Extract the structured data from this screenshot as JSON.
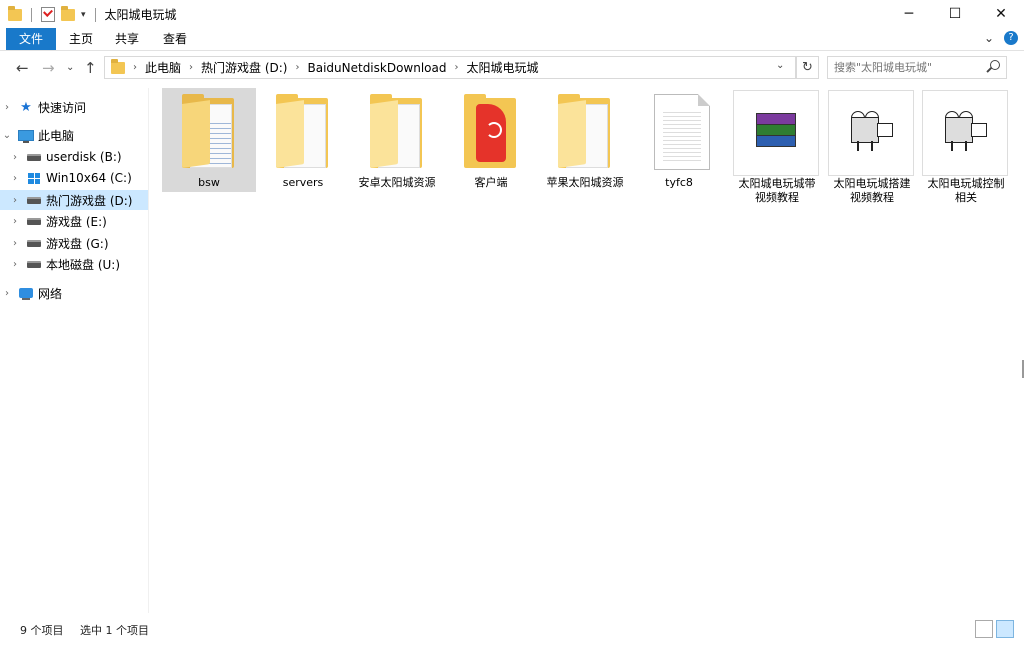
{
  "window": {
    "title": "太阳城电玩城",
    "controls": {
      "minimize": "─",
      "maximize": "☐",
      "close": "✕"
    }
  },
  "ribbon": {
    "tabs": {
      "file": "文件",
      "home": "主页",
      "share": "共享",
      "view": "查看"
    },
    "expand": "⌄",
    "help": "?"
  },
  "nav": {
    "back": "←",
    "forward": "→",
    "recent": "⌄",
    "up": "↑"
  },
  "address": {
    "crumbs": [
      "此电脑",
      "热门游戏盘 (D:)",
      "BaiduNetdiskDownload",
      "太阳城电玩城"
    ],
    "separator": "›",
    "dropdown": "⌄",
    "refresh": "↻"
  },
  "search": {
    "placeholder": "搜索\"太阳城电玩城\""
  },
  "sidebar": {
    "items": [
      {
        "label": "快速访问",
        "icon": "star-icon"
      },
      {
        "label": "此电脑",
        "icon": "computer-icon"
      },
      {
        "label": "userdisk (B:)",
        "icon": "drive-icon"
      },
      {
        "label": "Win10x64 (C:)",
        "icon": "windows-drive-icon"
      },
      {
        "label": "热门游戏盘 (D:)",
        "icon": "drive-icon",
        "selected": true
      },
      {
        "label": "游戏盘 (E:)",
        "icon": "drive-icon"
      },
      {
        "label": "游戏盘 (G:)",
        "icon": "drive-icon"
      },
      {
        "label": "本地磁盘 (U:)",
        "icon": "drive-icon"
      },
      {
        "label": "网络",
        "icon": "network-icon"
      }
    ],
    "collapsed_caret": "›",
    "expanded_caret": "⌄"
  },
  "files": [
    {
      "name": "bsw",
      "type": "folder",
      "icon": "folder-icon",
      "selected": true
    },
    {
      "name": "servers",
      "type": "folder",
      "icon": "folder-icon"
    },
    {
      "name": "安卓太阳城资源",
      "type": "folder",
      "icon": "folder-icon"
    },
    {
      "name": "客户端",
      "type": "app",
      "icon": "app-icon"
    },
    {
      "name": "苹果太阳城资源",
      "type": "folder",
      "icon": "folder-icon"
    },
    {
      "name": "tyfc8",
      "type": "file",
      "icon": "document-icon"
    },
    {
      "name": "太阳城电玩城带视频教程",
      "line1": "太阳城电玩城带",
      "line2": "视频教程",
      "type": "rar",
      "icon": "winrar-archive-icon"
    },
    {
      "name": "太阳电玩城搭建视频教程",
      "line1": "太阳电玩城搭建",
      "line2": "视频教程",
      "type": "video",
      "icon": "video-camera-icon"
    },
    {
      "name": "太阳电玩城控制相关",
      "line1": "太阳电玩城控制",
      "line2": "相关",
      "type": "video",
      "icon": "video-camera-icon"
    }
  ],
  "status": {
    "count": "9 个项目",
    "selection": "选中 1 个项目"
  },
  "colors": {
    "accent": "#1979ca",
    "selection": "#cce8ff",
    "folder": "#f3c653"
  }
}
